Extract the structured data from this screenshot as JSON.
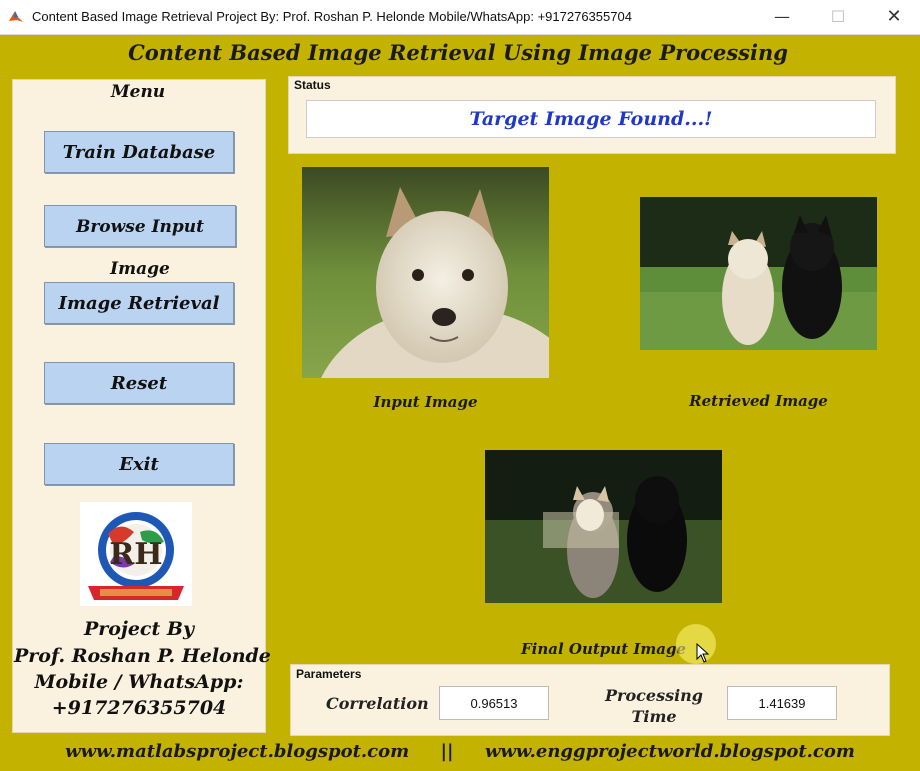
{
  "window": {
    "title": "Content Based Image Retrieval   Project By: Prof. Roshan P. Helonde   Mobile/WhatsApp: +917276355704",
    "minimize_glyph": "—",
    "maximize_glyph": "☐",
    "close_glyph": "✕"
  },
  "heading": "Content Based Image Retrieval Using Image Processing",
  "menu": {
    "title": "Menu",
    "buttons": {
      "train": "Train Database",
      "browse": "Browse Input Image",
      "retrieve": "Image Retrieval",
      "reset": "Reset",
      "exit": "Exit"
    }
  },
  "credits": {
    "line1": "Project By",
    "line2": "Prof. Roshan P. Helonde",
    "line3": "Mobile / WhatsApp:",
    "line4": "+917276355704"
  },
  "status": {
    "label": "Status",
    "message": "Target Image Found...!"
  },
  "images": {
    "input_caption": "Input Image",
    "retrieved_caption": "Retrieved Image",
    "output_caption": "Final Output Image"
  },
  "parameters": {
    "label": "Parameters",
    "correlation_label": "Correlation",
    "correlation_value": "0.96513",
    "processing_time_label_1": "Processing",
    "processing_time_label_2": "Time",
    "processing_time_value": "1.41639"
  },
  "footer": "www.matlabsproject.blogspot.com     ||     www.enggprojectworld.blogspot.com",
  "colors": {
    "background": "#c4b200",
    "panel": "#fbf1df",
    "button": "#b9d3f0",
    "status_text": "#2038c8"
  }
}
